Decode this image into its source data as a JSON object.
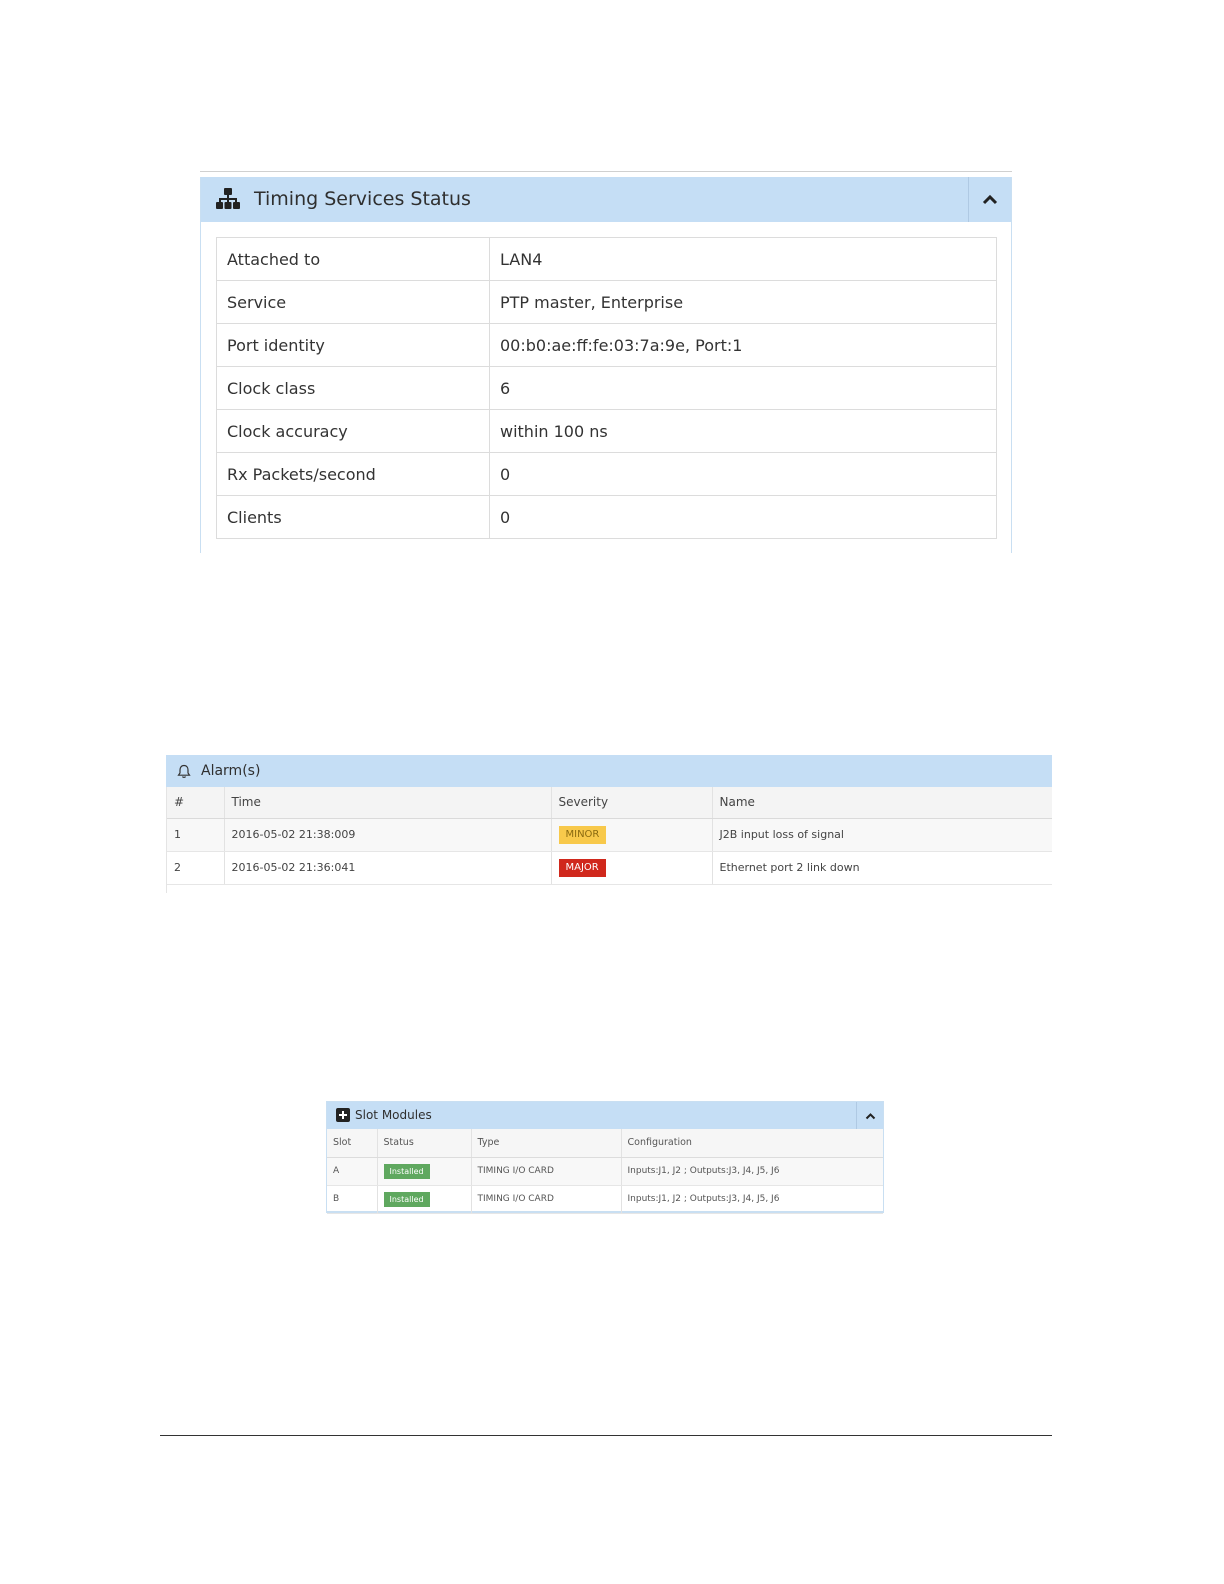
{
  "timing_panel": {
    "title": "Timing Services Status",
    "rows": [
      {
        "label": "Attached to",
        "value": "LAN4"
      },
      {
        "label": "Service",
        "value": "PTP master, Enterprise"
      },
      {
        "label": "Port identity",
        "value": "00:b0:ae:ff:fe:03:7a:9e, Port:1"
      },
      {
        "label": "Clock class",
        "value": "6"
      },
      {
        "label": "Clock accuracy",
        "value": "within 100 ns"
      },
      {
        "label": "Rx Packets/second",
        "value": "0"
      },
      {
        "label": "Clients",
        "value": "0"
      }
    ]
  },
  "alarms_panel": {
    "title": "Alarm(s)",
    "columns": [
      "#",
      "Time",
      "Severity",
      "Name"
    ],
    "rows": [
      {
        "num": "1",
        "time": "2016-05-02 21:38:009",
        "severity": "MINOR",
        "name": "J2B input loss of signal"
      },
      {
        "num": "2",
        "time": "2016-05-02 21:36:041",
        "severity": "MAJOR",
        "name": "Ethernet port 2 link down"
      }
    ]
  },
  "slot_panel": {
    "title": "Slot Modules",
    "columns": [
      "Slot",
      "Status",
      "Type",
      "Configuration"
    ],
    "rows": [
      {
        "slot": "A",
        "status": "Installed",
        "type": "TIMING I/O CARD",
        "config": "Inputs:J1, J2 ; Outputs:J3, J4, J5, J6"
      },
      {
        "slot": "B",
        "status": "Installed",
        "type": "TIMING I/O CARD",
        "config": "Inputs:J1, J2 ; Outputs:J3, J4, J5, J6"
      }
    ]
  },
  "colors": {
    "panel_header": "#c5def5",
    "minor_badge": "#f8c94b",
    "major_badge": "#d0281c",
    "installed_badge": "#5fa85f"
  },
  "icons": {
    "timing": "sitemap-icon",
    "alarms": "bell-icon",
    "slots": "plus-square-icon",
    "collapse": "chevron-up-icon"
  }
}
